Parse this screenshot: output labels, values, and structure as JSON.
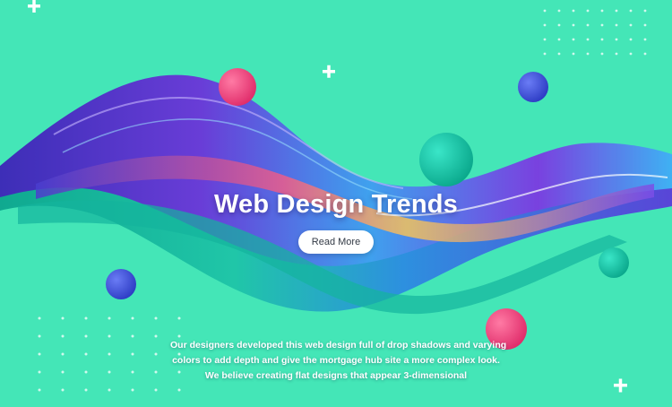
{
  "hero": {
    "title": "Web Design Trends",
    "button_label": "Read More",
    "description_lines": [
      "Our designers developed this web design full of drop shadows and varying",
      "colors to add depth and give the mortgage hub site a more complex look.",
      "We believe creating flat designs that appear 3-dimensional"
    ]
  },
  "colors": {
    "background": "#44e6b7",
    "accent_pink": "#f0447a",
    "accent_blue": "#3d51d6",
    "accent_teal": "#18c7a7"
  }
}
